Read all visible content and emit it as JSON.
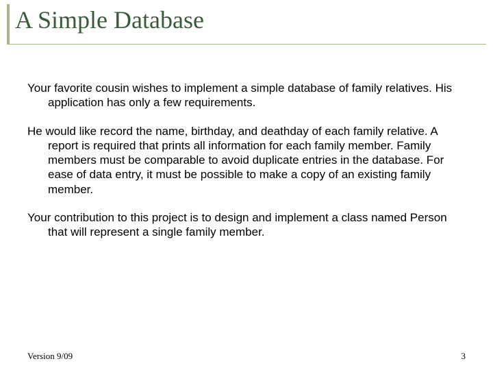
{
  "title": "A Simple Database",
  "paragraphs": [
    "Your favorite cousin wishes to implement a simple database of family relatives.  His application has only a few requirements.",
    "He would like record the name, birthday, and deathday of each family relative.  A report is required that prints all information for each family member.  Family members must be comparable to avoid duplicate entries in the database.  For ease of data entry, it must be possible to make a copy of an existing family member.",
    "Your contribution to this project is to design and implement a class named Person that will represent a single family member."
  ],
  "footer": {
    "version": "Version 9/09",
    "page": "3"
  }
}
